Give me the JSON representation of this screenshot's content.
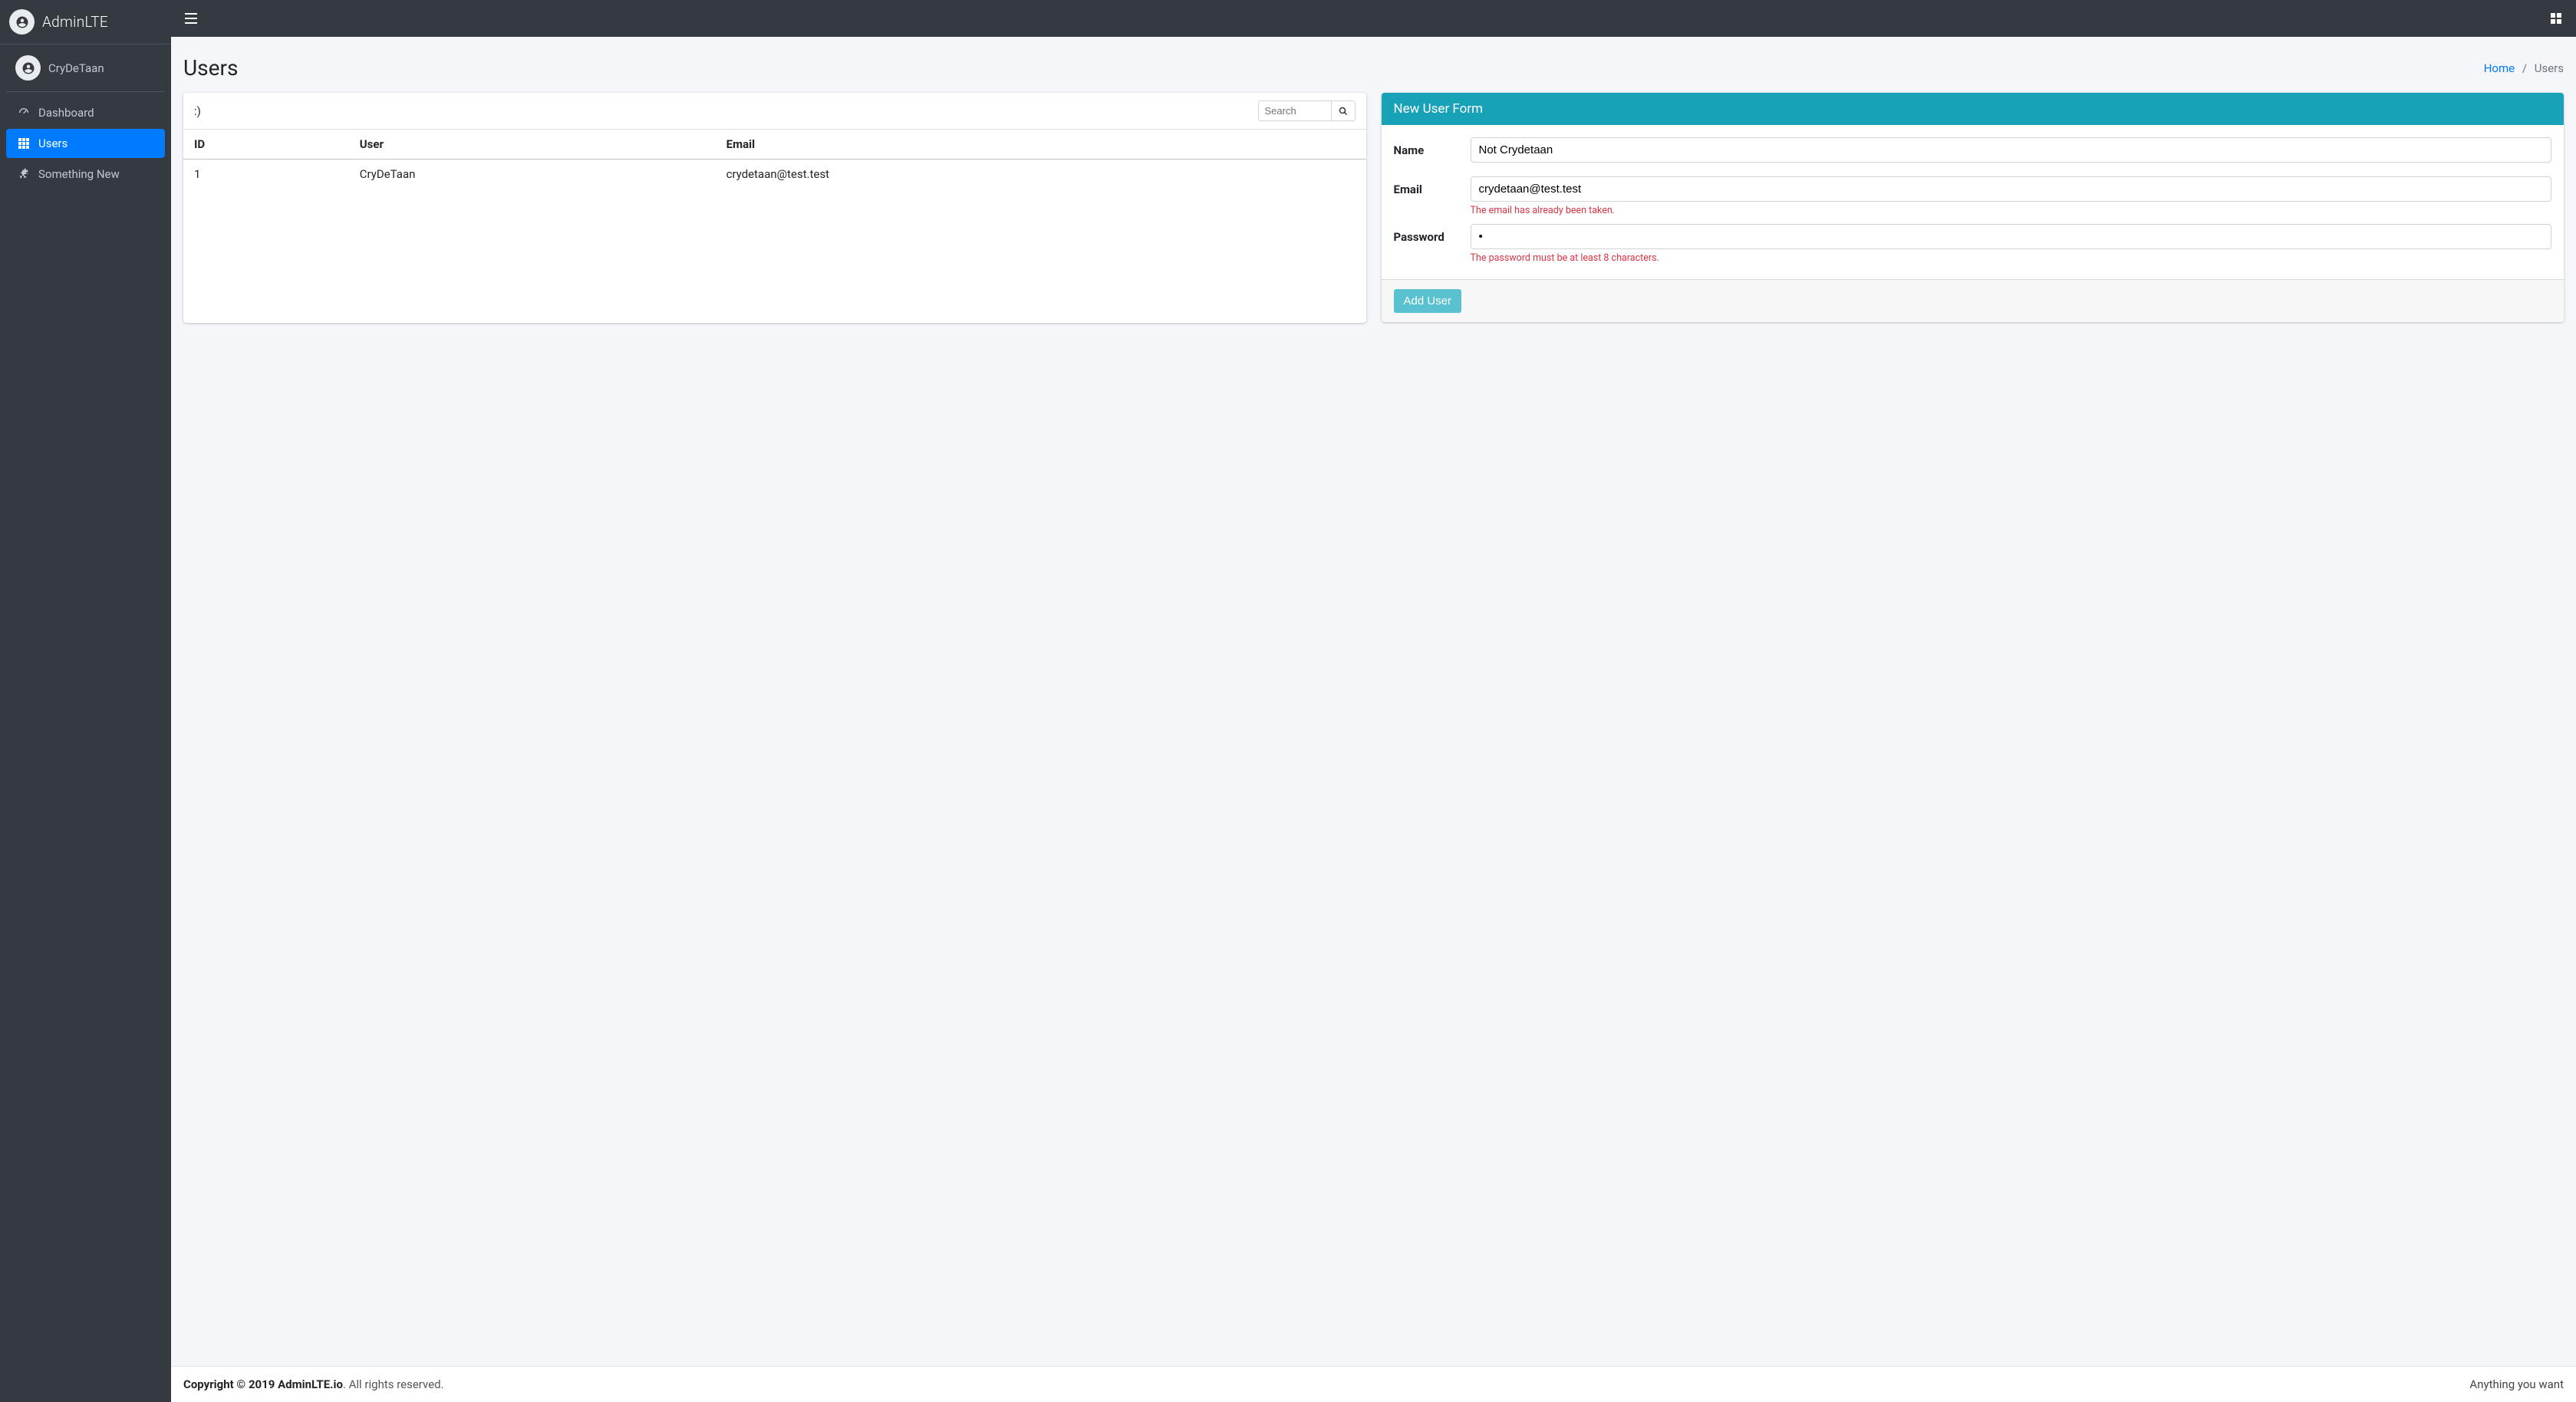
{
  "brand": {
    "name": "AdminLTE"
  },
  "user": {
    "name": "CryDeTaan"
  },
  "sidebar": {
    "items": [
      {
        "label": "Dashboard",
        "active": false
      },
      {
        "label": "Users",
        "active": true
      },
      {
        "label": "Something New",
        "active": false
      }
    ]
  },
  "header": {
    "title": "Users",
    "breadcrumb_home": "Home",
    "breadcrumb_current": "Users"
  },
  "users_card": {
    "title": ":)",
    "search_placeholder": "Search",
    "columns": {
      "id": "ID",
      "user": "User",
      "email": "Email"
    },
    "rows": [
      {
        "id": "1",
        "user": "CryDeTaan",
        "email": "crydetaan@test.test"
      }
    ]
  },
  "form_card": {
    "title": "New User Form",
    "name_label": "Name",
    "name_value": "Not Crydetaan",
    "email_label": "Email",
    "email_value": "crydetaan@test.test",
    "email_error": "The email has already been taken.",
    "password_label": "Password",
    "password_value": "•",
    "password_error": "The password must be at least 8 characters.",
    "submit_label": "Add User"
  },
  "footer": {
    "copyright_bold": "Copyright © 2019 AdminLTE.io",
    "copyright_rest": ". All rights reserved.",
    "right_text": "Anything you want"
  }
}
